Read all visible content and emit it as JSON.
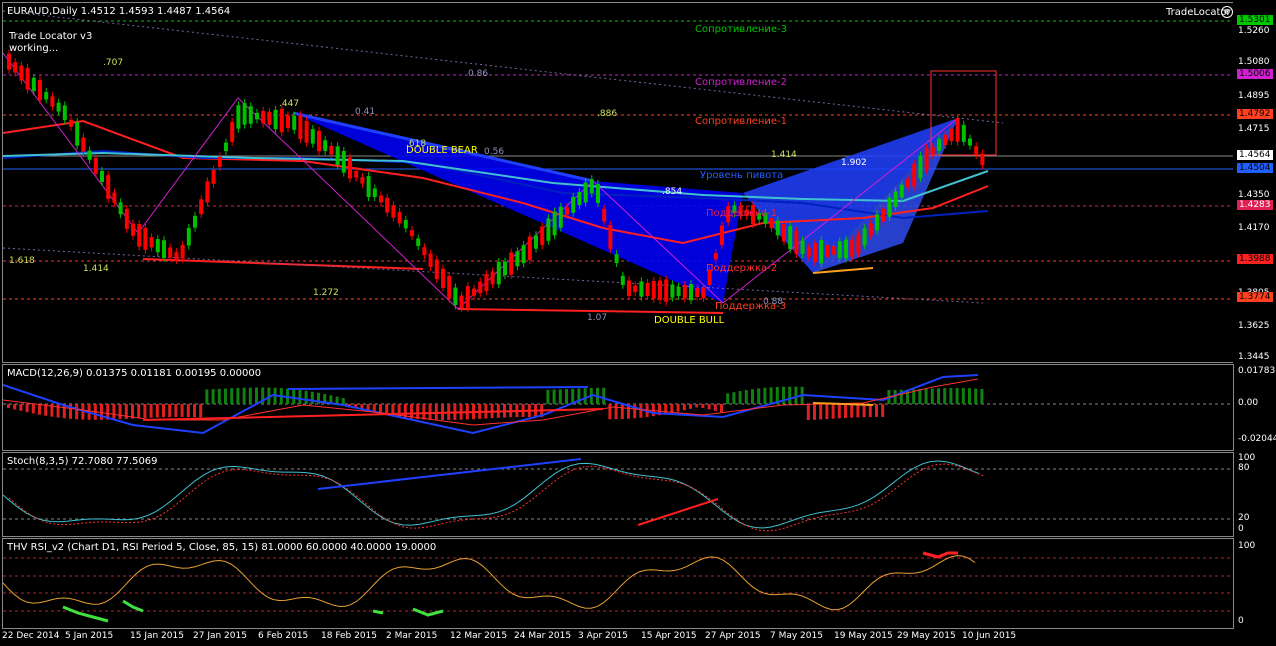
{
  "header": {
    "symbol_line": "EURAUD,Daily  1.4512 1.4593 1.4487 1.4564",
    "indicator_name": "Trade Locator v3",
    "indicator_status": "working...",
    "brand": "TradeLocator"
  },
  "main_labels": {
    "resistance3": "Сопротивление-3",
    "resistance2": "Сопротивление-2",
    "resistance1": "Сопротивление-1",
    "pivot": "Уровень пивота",
    "support1": "Поддержка-1",
    "support2": "Поддержка-2",
    "support3": "Поддержка-3",
    "double_bear": "DOUBLE  BEAR",
    "double_bull": "DOUBLE  BULL"
  },
  "fib_labels": [
    ".707",
    ".447",
    "0.41",
    "0.86",
    ".886",
    ".618",
    "0.56",
    "1.414",
    "1.902",
    ".854",
    "1.618",
    "1.414",
    "1.272",
    "1.07",
    "0.88"
  ],
  "price_scale": {
    "ticks": [
      "1.5260",
      "1.5080",
      "1.4895",
      "1.4715",
      "1.4530",
      "1.4350",
      "1.4170",
      "1.3805",
      "1.3625",
      "1.3445"
    ],
    "highlighted": [
      {
        "value": "1.5301",
        "color": "#00c800"
      },
      {
        "value": "1.5006",
        "color": "#d020d0"
      },
      {
        "value": "1.4792",
        "color": "#ff4020"
      },
      {
        "value": "1.4564",
        "color": "#ffffff"
      },
      {
        "value": "1.4504",
        "color": "#2060ff"
      },
      {
        "value": "1.4283",
        "color": "#e02050"
      },
      {
        "value": "1.3988",
        "color": "#ff2020"
      },
      {
        "value": "1.3774",
        "color": "#ff4020"
      }
    ]
  },
  "macd": {
    "title": "MACD(12,26,9) 0.01375 0.01181 0.00195 0.00000",
    "ticks": [
      "0.01783",
      "0.00",
      "-0.02044"
    ]
  },
  "stoch": {
    "title": "Stoch(8,3,5) 72.7080 77.5069",
    "ticks": [
      "100",
      "80",
      "20",
      "0"
    ]
  },
  "rsi": {
    "title": "THV RSI_v2  (Chart D1,  RSI Period 5,  Close,  85,  15)  81.0000 60.0000 40.0000 19.0000",
    "ticks": [
      "100",
      "0"
    ]
  },
  "dates": [
    "22 Dec 2014",
    "5 Jan 2015",
    "15 Jan 2015",
    "27 Jan 2015",
    "6 Feb 2015",
    "18 Feb 2015",
    "2 Mar 2015",
    "12 Mar 2015",
    "24 Mar 2015",
    "3 Apr 2015",
    "15 Apr 2015",
    "27 Apr 2015",
    "7 May 2015",
    "19 May 2015",
    "29 May 2015",
    "10 Jun 2015"
  ],
  "colors": {
    "bull": "#00c000",
    "bear": "#ff0000",
    "resistance3": "#00c800",
    "resistance2": "#d020d0",
    "resistance1": "#ff4020",
    "pivot": "#2060ff",
    "support1": "#e02050",
    "support2": "#ff3030",
    "support3": "#ff4020"
  }
}
